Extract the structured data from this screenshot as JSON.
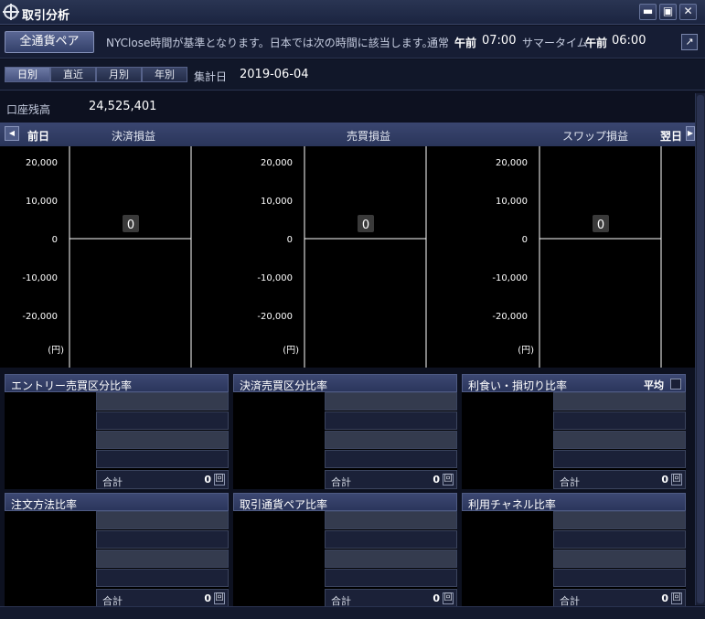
{
  "window": {
    "title": "取引分析",
    "buttons": {
      "minimize": "▬",
      "restore": "▣",
      "close": "✕"
    }
  },
  "info": {
    "all_pair_button": "全通貨ペア",
    "notice": "NYClose時間が基準となります。日本では次の時間に該当します。",
    "normal_label": "通常",
    "normal_ampm": "午前",
    "normal_time": "07:00",
    "summer_label": "サマータイム",
    "summer_ampm": "午前",
    "summer_time": "06:00",
    "external_icon": "↗"
  },
  "period": {
    "tabs": [
      {
        "label": "日別",
        "active": true
      },
      {
        "label": "直近",
        "active": false
      },
      {
        "label": "月別",
        "active": false
      },
      {
        "label": "年別",
        "active": false
      }
    ],
    "agg_label": "集計日",
    "agg_date": "2019-06-04"
  },
  "balance": {
    "label": "口座残高",
    "value": "24,525,401"
  },
  "charts_header": {
    "prev": "前日",
    "next": "翌日",
    "prev_icon": "◀",
    "next_icon": "▶"
  },
  "chart_data": [
    {
      "type": "bar",
      "title": "決済損益",
      "categories": [],
      "values": [
        0
      ],
      "value_label": "0",
      "yticks": [
        "20,000",
        "10,000",
        "0",
        "-10,000",
        "-20,000"
      ],
      "unit": "(円)",
      "ylim": [
        -28000,
        28000
      ]
    },
    {
      "type": "bar",
      "title": "売買損益",
      "categories": [],
      "values": [
        0
      ],
      "value_label": "0",
      "yticks": [
        "20,000",
        "10,000",
        "0",
        "-10,000",
        "-20,000"
      ],
      "unit": "(円)",
      "ylim": [
        -28000,
        28000
      ]
    },
    {
      "type": "bar",
      "title": "スワップ損益",
      "categories": [],
      "values": [
        0
      ],
      "value_label": "0",
      "yticks": [
        "20,000",
        "10,000",
        "0",
        "-10,000",
        "-20,000"
      ],
      "unit": "(円)",
      "ylim": [
        -28000,
        28000
      ]
    }
  ],
  "panels": [
    {
      "title": "エントリー売買区分比率",
      "total_label": "合計",
      "total": "0",
      "unit": "回"
    },
    {
      "title": "決済売買区分比率",
      "total_label": "合計",
      "total": "0",
      "unit": "回"
    },
    {
      "title": "利食い・損切り比率",
      "total_label": "合計",
      "total": "0",
      "unit": "回",
      "avg_label": "平均"
    },
    {
      "title": "注文方法比率",
      "total_label": "合計",
      "total": "0",
      "unit": "回"
    },
    {
      "title": "取引通貨ペア比率",
      "total_label": "合計",
      "total": "0",
      "unit": "回"
    },
    {
      "title": "利用チャネル比率",
      "total_label": "合計",
      "total": "0",
      "unit": "回"
    }
  ]
}
